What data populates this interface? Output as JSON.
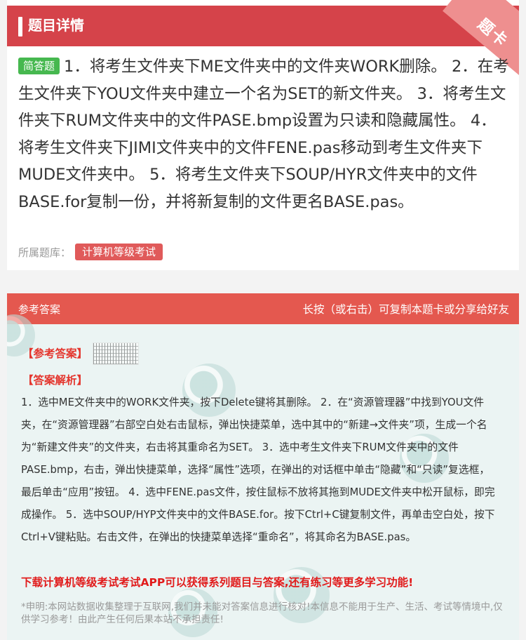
{
  "header": {
    "title": "题目详情",
    "corner_label": "题卡"
  },
  "question": {
    "type_badge": "简答题",
    "text": "1．将考生文件夹下ME文件夹中的文件夹WORK删除。 2．在考生文件夹下YOU文件夹中建立一个名为SET的新文件夹。 3．将考生文件夹下RUM文件夹中的文件PASE.bmp设置为只读和隐藏属性。 4．将考生文件夹下JIMI文件夹中的文件FENE.pas移动到考生文件夹下MUDE文件夹中。 5．将考生文件夹下SOUP/HYR文件夹中的文件BASE.for复制一份，并将新复制的文件更名BASE.pas。"
  },
  "bank": {
    "label": "所属题库：",
    "tag": "计算机等级考试"
  },
  "answer": {
    "title": "参考答案",
    "hint": "长按（或右击）可复制本题卡或分享给好友",
    "ref_label": "【参考答案】",
    "analysis_label": "【答案解析】",
    "analysis_text": "1．选中ME文件夹中的WORK文件夹，按下Delete键将其删除。 2．在“资源管理器”中找到YOU文件夹，在“资源管理器”右部空白处右击鼠标，弹出快捷菜单，选中其中的“新建→文件夹”项，生成一个名为“新建文件夹”的文件夹，右击将其重命名为SET。 3．选中考生文件夹下RUM文件夹中的文件PASE.bmp，右击，弹出快捷菜单，选择“属性”选项，在弹出的对话框中单击“隐藏”和“只读”复选框，最后单击“应用”按钮。 4．选中FENE.pas文件，按住鼠标不放将其拖到MUDE文件夹中松开鼠标，即完成操作。 5．选中SOUP/HYP文件夹中的文件BASE.for。按下Ctrl+C键复制文件，再单击空白处，按下Ctrl+V键粘贴。右击文件，在弹出的快捷菜单选择“重命名”，将其命名为BASE.pas。",
    "promo": "下载计算机等级考试考试APP可以获得系列题目与答案,还有练习等更多学习功能!",
    "disclaimer": "*申明:本网站数据收集整理于互联网,我们并未能对答案信息进行核对!本信息不能用于生产、生活、考试等情境中,仅供学习参考！由此产生任何后果本站不承担责任!"
  },
  "colors": {
    "header_red": "#d5434a",
    "answer_header_red": "#e4584f",
    "badge_green": "#46b84f",
    "tag_red": "#e05a5a",
    "highlight_red": "#e4362e"
  }
}
